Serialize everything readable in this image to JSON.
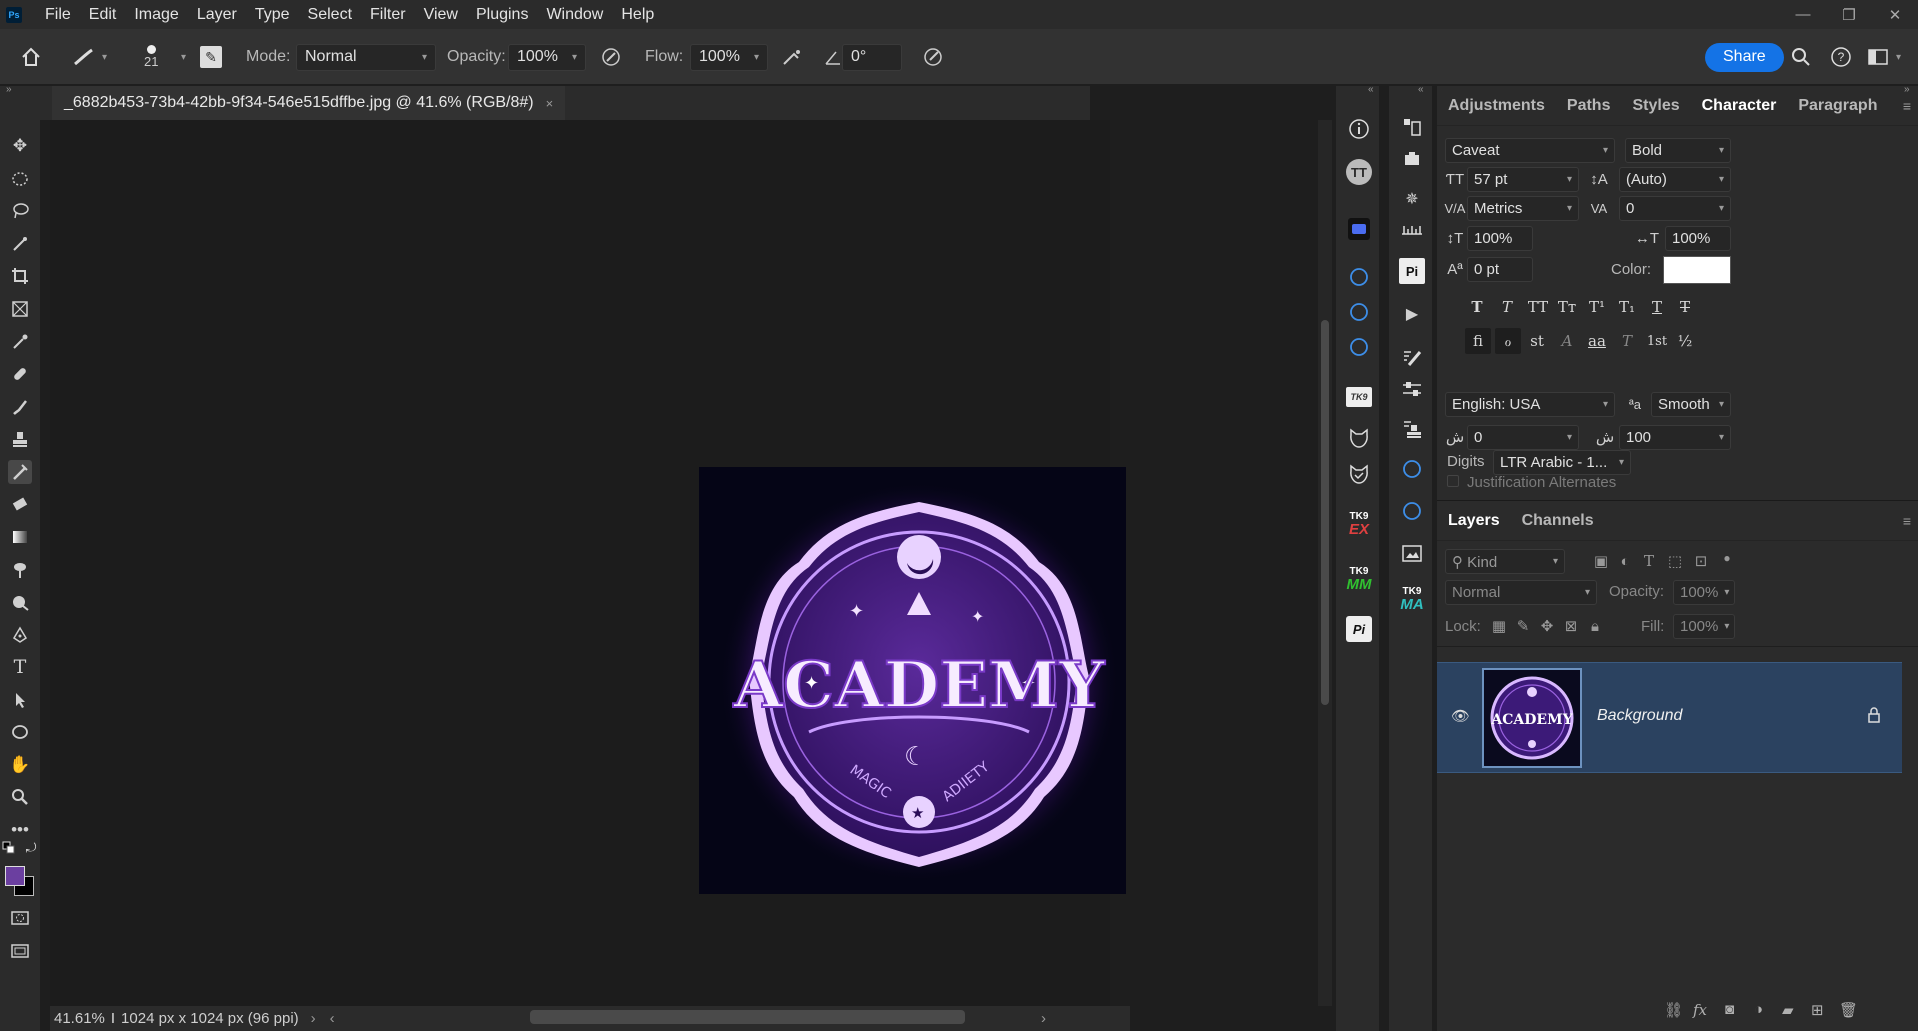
{
  "app": {
    "logo": "Ps"
  },
  "menu": [
    "File",
    "Edit",
    "Image",
    "Layer",
    "Type",
    "Select",
    "Filter",
    "View",
    "Plugins",
    "Window",
    "Help"
  ],
  "window_controls": {
    "minimize": "—",
    "restore": "❐",
    "close": "✕"
  },
  "options_bar": {
    "brush_size": "21",
    "mode_label": "Mode:",
    "mode_value": "Normal",
    "opacity_label": "Opacity:",
    "opacity_value": "100%",
    "flow_label": "Flow:",
    "flow_value": "100%",
    "angle_value": "0°",
    "share_label": "Share"
  },
  "document": {
    "tab_title": "_6882b453-73b4-42bb-9f34-546e515dffbe.jpg @ 41.6% (RGB/8#)",
    "tab_close": "×",
    "zoom": "41.61%",
    "doc_info": "1024 px x 1024 px (96 ppi)",
    "artwork": {
      "title": "ACADEMY",
      "subtitle_left": "MAGIC",
      "subtitle_right": "ADIIETY"
    }
  },
  "colors": {
    "foreground": "#6b3fa0",
    "background": "#000000",
    "accent": "#1473e6",
    "layer_selected": "#2b4260"
  },
  "character_panel": {
    "tabs": [
      "Adjustments",
      "Paths",
      "Styles",
      "Character",
      "Paragraph"
    ],
    "active_tab": "Character",
    "font_family": "Caveat",
    "font_style": "Bold",
    "font_size": "57 pt",
    "leading": "(Auto)",
    "kerning": "Metrics",
    "tracking": "0",
    "vertical_scale": "100%",
    "horizontal_scale": "100%",
    "baseline_shift": "0 pt",
    "color_label": "Color:",
    "text_color": "#ffffff",
    "language": "English: USA",
    "antialias_icon_text": "ªa",
    "antialias": "Smooth",
    "arabic_left": "0",
    "arabic_right": "100",
    "digits_label": "Digits",
    "digits_value": "LTR Arabic - 1...",
    "justification_label": "Justification Alternates",
    "style_buttons_row1": [
      "T",
      "T",
      "TT",
      "Tт",
      "T¹",
      "T₁",
      "T",
      "T"
    ],
    "style_buttons_row2": [
      "ﬁ",
      "ℴ",
      "st",
      "A",
      "aa",
      "T",
      "1st",
      "½"
    ]
  },
  "layers_panel": {
    "tabs": [
      "Layers",
      "Channels"
    ],
    "active_tab": "Layers",
    "filter_placeholder": "Kind",
    "blend_mode": "Normal",
    "opacity_label": "Opacity:",
    "opacity_value": "100%",
    "lock_label": "Lock:",
    "fill_label": "Fill:",
    "fill_value": "100%",
    "layers": [
      {
        "name": "Background",
        "visible": true,
        "locked": true,
        "thumb_text": "ACADEMY"
      }
    ],
    "footer_icons": [
      "link-icon",
      "fx-icon",
      "mask-icon",
      "adjustment-icon",
      "group-icon",
      "new-layer-icon",
      "trash-icon"
    ]
  },
  "strip_labels": {
    "tk_ex_top": "TK9",
    "tk_ex": "EX",
    "tk_mm_top": "TK9",
    "tk_mm": "MM",
    "tk_ma_top": "TK9",
    "tk_ma": "MA",
    "tt": "TT",
    "pi": "Pi"
  }
}
